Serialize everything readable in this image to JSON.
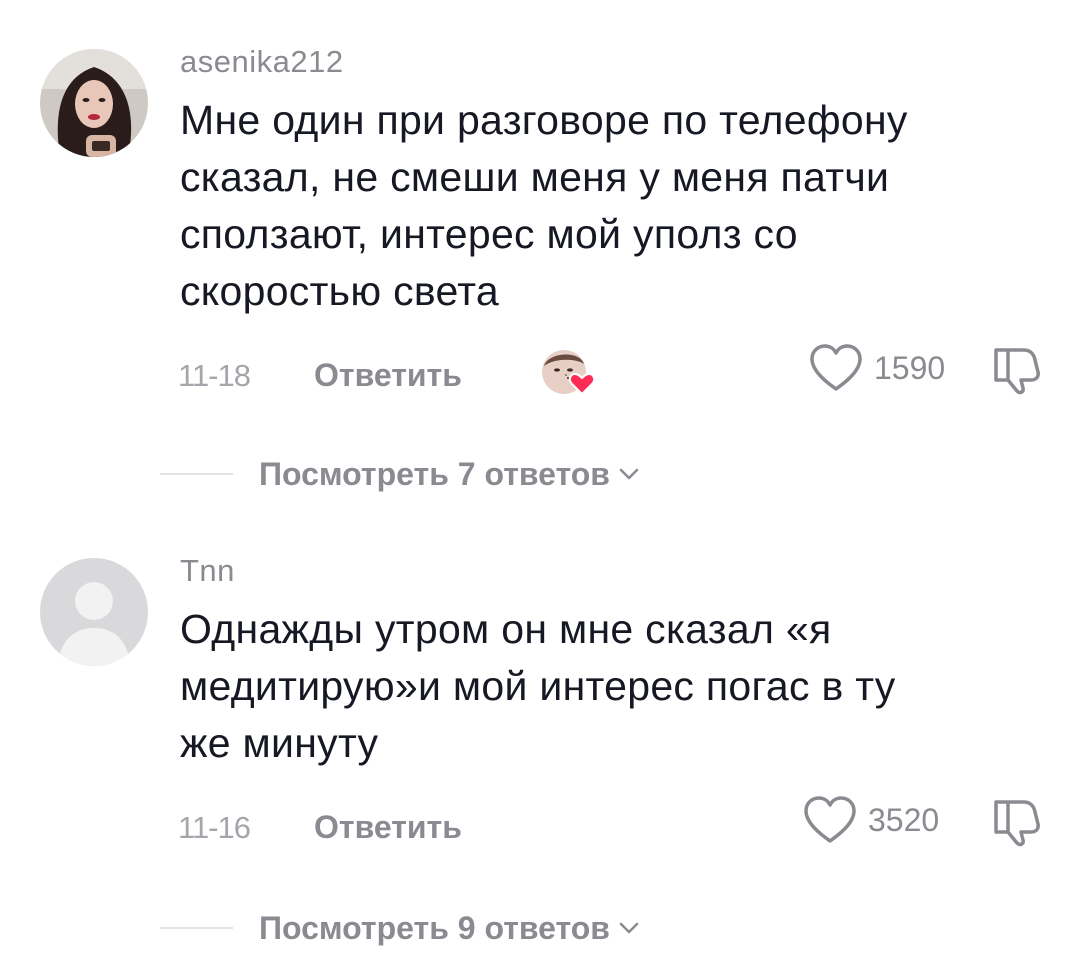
{
  "comments": [
    {
      "avatar_icon": "user-photo-avatar",
      "username": "asenika212",
      "text_lines": [
        "Мне один при разговоре по телефону",
        "сказал, не смеши меня у меня патчи",
        "сползают, интерес мой уполз со",
        "скоростью света"
      ],
      "date": "11-18",
      "reply_label": "Ответить",
      "creator_liked": true,
      "like_count": "1590",
      "view_replies_label": "Посмотреть 7 ответов"
    },
    {
      "avatar_icon": "default-user-avatar",
      "username": "Tnn",
      "text_lines": [
        "Однажды утром он мне сказал «я",
        "медитирую»и мой интерес погас в ту",
        "же минуту"
      ],
      "date": "11-16",
      "reply_label": "Ответить",
      "creator_liked": false,
      "like_count": "3520",
      "view_replies_label": "Посмотреть 9 ответов"
    }
  ],
  "colors": {
    "text_primary": "#161823",
    "text_secondary": "#8a8b91",
    "heart_badge": "#fe2c55",
    "default_avatar_bg": "#d9d9dc"
  }
}
